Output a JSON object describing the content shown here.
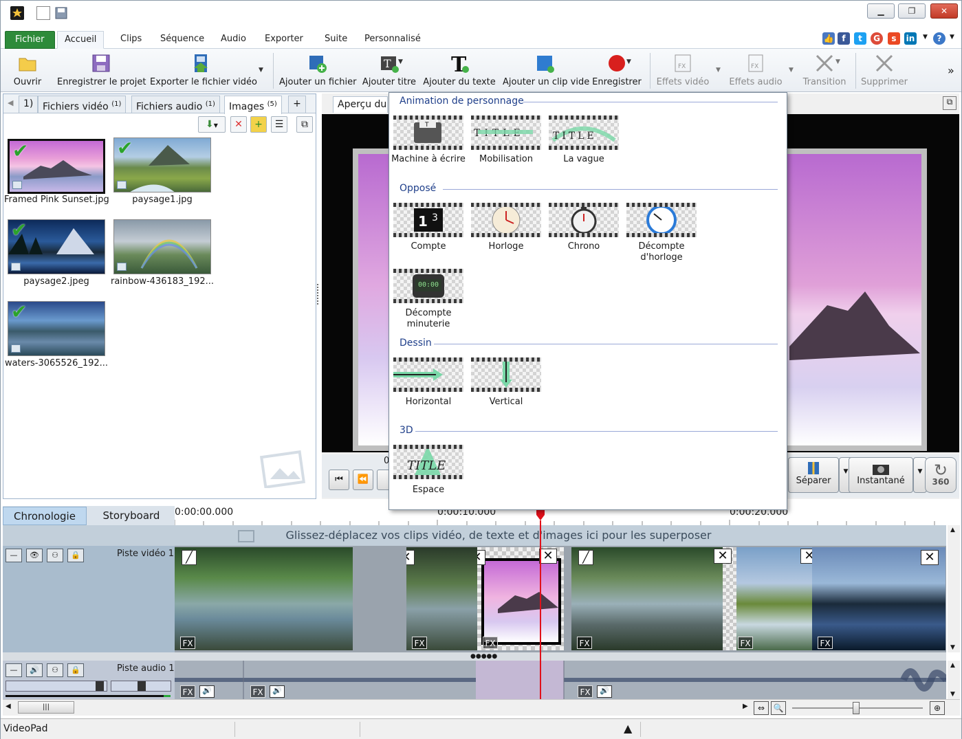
{
  "app": {
    "title_bar_buttons": [
      "minimize",
      "restore",
      "close"
    ],
    "close_glyph": "✕",
    "minimize_glyph": "▁",
    "restore_glyph": "❐"
  },
  "menu": {
    "file": "Fichier",
    "tabs": [
      "Accueil",
      "Clips",
      "Séquence",
      "Audio",
      "Exporter",
      "Suite",
      "Personnalisé"
    ],
    "active": "Accueil"
  },
  "social_icons": [
    "like-icon",
    "facebook-icon",
    "twitter-icon",
    "google-plus-icon",
    "stumbleupon-icon",
    "linkedin-icon",
    "help-icon"
  ],
  "ribbon": {
    "open": "Ouvrir",
    "save_project": "Enregistrer le projet",
    "export_video": "Exporter le fichier vidéo",
    "add_file": "Ajouter un fichier",
    "add_title": "Ajouter titre",
    "add_text": "Ajouter du texte",
    "add_blank": "Ajouter un clip vide",
    "record": "Enregistrer",
    "video_effects": "Effets vidéo",
    "audio_effects": "Effets audio",
    "transition": "Transition",
    "delete": "Supprimer",
    "more": "»"
  },
  "media": {
    "tabs": [
      {
        "label": "1)",
        "count": ""
      },
      {
        "label": "Fichiers vidéo",
        "count": "(1)"
      },
      {
        "label": "Fichiers audio",
        "count": "(1)"
      },
      {
        "label": "Images",
        "count": "(5)"
      }
    ],
    "add_tab": "+",
    "items": [
      {
        "name": "Framed Pink Sunset.jpg",
        "checked": true
      },
      {
        "name": "paysage1.jpg",
        "checked": true
      },
      {
        "name": "paysage2.jpeg",
        "checked": true
      },
      {
        "name": "rainbow-436183_192...",
        "checked": false
      },
      {
        "name": "waters-3065526_192...",
        "checked": true
      }
    ]
  },
  "preview": {
    "tab_label": "Aperçu du",
    "split_label": "Séparer",
    "snapshot_label": "Instantané",
    "vr_label": "360",
    "timecode_fragment": "0"
  },
  "title_menu": {
    "sections": [
      {
        "title": "Animation de personnage",
        "items": [
          "Machine à écrire",
          "Mobilisation",
          "La vague"
        ]
      },
      {
        "title": "Opposé",
        "items": [
          "Compte",
          "Horloge",
          "Chrono",
          "Décompte d'horloge",
          "Décompte minuterie"
        ]
      },
      {
        "title": "Dessin",
        "items": [
          "Horizontal",
          "Vertical"
        ]
      },
      {
        "title": "3D",
        "items": [
          "Espace"
        ]
      }
    ],
    "decompte_horloge_l1": "Décompte",
    "decompte_horloge_l2": "d'horloge",
    "decompte_minuterie_l1": "Décompte",
    "decompte_minuterie_l2": "minuterie",
    "timer_display": "00:00"
  },
  "timeline": {
    "tabs": [
      "Chronologie",
      "Storyboard"
    ],
    "active_tab": "Chronologie",
    "ruler": [
      "0:00:00.000",
      "0:00:10.000",
      "0:00:20.000"
    ],
    "overlay_hint": "Glissez-déplacez vos clips vidéo, de texte et d'images ici pour les superposer",
    "video_track": "Piste vidéo 1",
    "audio_track": "Piste audio 1",
    "fx_label": "FX"
  },
  "status": {
    "app_name": "VideoPad"
  },
  "colors": {
    "accent_green": "#2e8b3a",
    "playhead": "#e0101a",
    "section_title": "#1f3f8a"
  }
}
